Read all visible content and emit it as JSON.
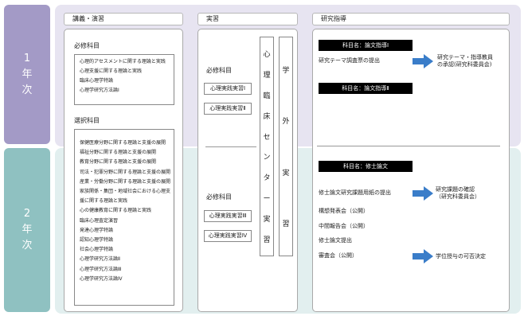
{
  "years": {
    "y1": [
      "1",
      "年",
      "次"
    ],
    "y2": [
      "2",
      "年",
      "次"
    ]
  },
  "columns": {
    "lecture": "講義・演習",
    "practice": "実習",
    "research": "研究指導"
  },
  "lecture": {
    "required_label": "必修科目",
    "required_items": [
      "心理的アセスメントに関する理論と実践",
      "心理支援に関する理論と実践",
      "臨床心理学特論",
      "心理学研究方法論Ⅰ"
    ],
    "elective_label": "選択科目",
    "elective_items": [
      "保健医療分野に関する理論と支援の展開",
      "福祉分野に関する理論と支援の展開",
      "教育分野に関する理論と支援の展開",
      "司法・犯罪分野に関する理論と支援の展開",
      "産業・労働分野に関する理論と支援の展開",
      "家族関係・集団・地域社会における心理支",
      "援に関する理論と実践",
      "心の健康教育に関する理論と実践",
      "臨床心理査定演習",
      "発達心理学特論",
      "認知心理学特論",
      "社会心理学特論",
      "心理学研究方法論Ⅱ",
      "心理学研究方法論Ⅲ",
      "心理学研究方法論Ⅳ"
    ]
  },
  "practice": {
    "y1_label": "必修科目",
    "y1_items": [
      "心理実践実習Ⅰ",
      "心理実践実習Ⅱ"
    ],
    "y2_label": "必修科目",
    "y2_items": [
      "心理実践実習Ⅲ",
      "心理実践実習Ⅳ"
    ],
    "center_vertical": [
      "心",
      "理",
      "臨",
      "床",
      "セ",
      "ン",
      "タ",
      "ー",
      "実",
      "習"
    ],
    "external_vertical": [
      "学",
      "外",
      "実",
      "習"
    ]
  },
  "research": {
    "y1_bar1": "科目名：論文指導Ⅰ",
    "y1_item": "研究テーマ調査票の提出",
    "y1_result_line1": "研究テーマ・指導教員",
    "y1_result_line2": "の承認(研究科委員会)",
    "y1_bar2": "科目名：論文指導Ⅱ",
    "y2_bar": "科目名：修士論文",
    "y2_item1": "修士論文研究課題用紙の提出",
    "y2_result1_line1": "研究課題の確認",
    "y2_result1_line2": "（研究科委員会）",
    "y2_item2": "構想発表会（公開）",
    "y2_item3": "中間報告会（公開）",
    "y2_item4": "修士論文提出",
    "y2_item5": "審査会（公開）",
    "y2_result2": "学位授与の可否決定"
  },
  "colors": {
    "year1_tab": "#a39ac6",
    "year1_bg": "#e7e4f1",
    "year2_tab": "#8fc1c1",
    "year2_bg": "#e2efef",
    "arrow": "#3a7dc9"
  }
}
